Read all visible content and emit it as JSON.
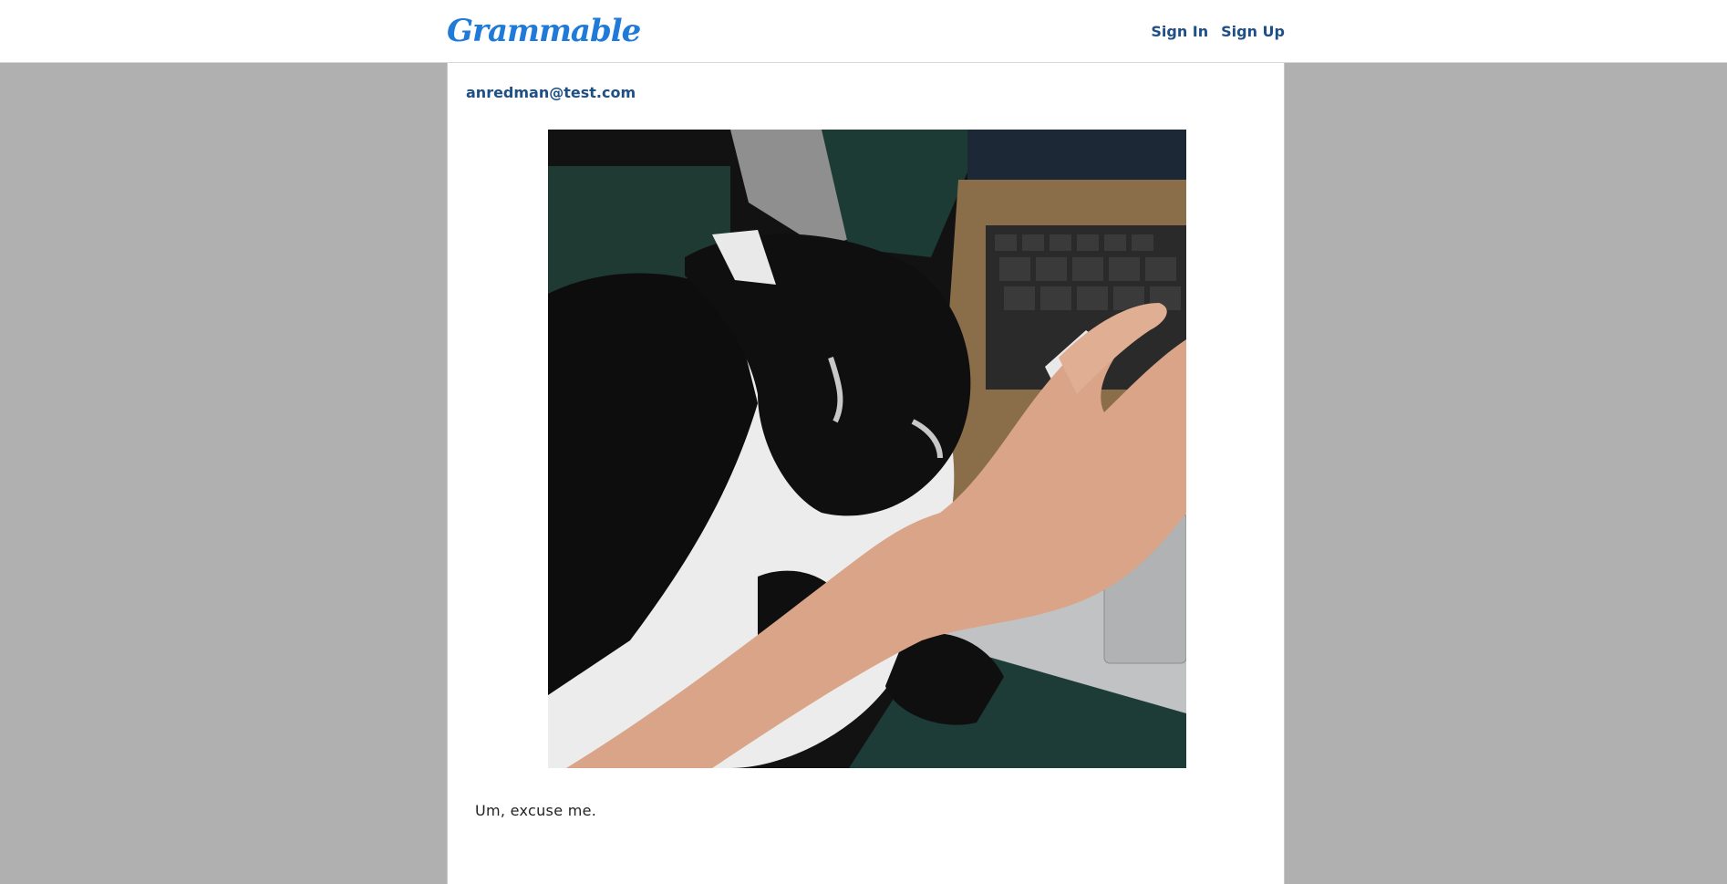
{
  "navbar": {
    "brand": "Grammable",
    "links": [
      {
        "label": "Sign In"
      },
      {
        "label": "Sign Up"
      }
    ]
  },
  "post": {
    "author": "anredman@test.com",
    "caption": "Um, excuse me."
  }
}
